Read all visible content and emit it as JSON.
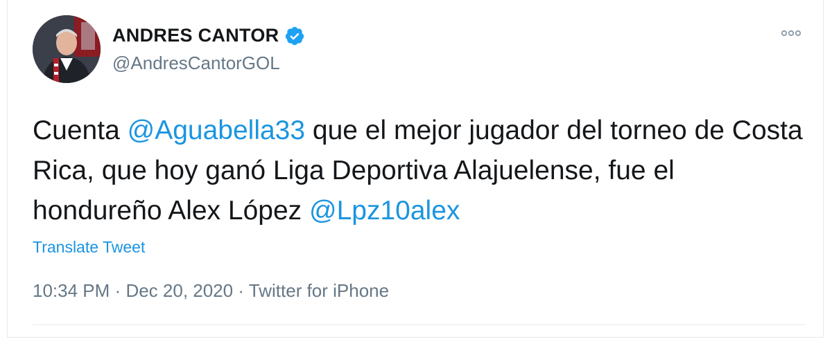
{
  "tweet": {
    "author": {
      "display_name": "ANDRES CANTOR",
      "handle": "@AndresCantorGOL"
    },
    "text": {
      "p1": "Cuenta ",
      "mention1": "@Aguabella33",
      "p2": " que el mejor jugador del torneo de Costa Rica, que hoy ganó Liga Deportiva Alajuelense, fue el hondureño Alex López ",
      "mention2": "@Lpz10alex"
    },
    "translate_label": "Translate Tweet",
    "time": "10:34 PM",
    "date": "Dec 20, 2020",
    "source": "Twitter for iPhone",
    "separator": "·"
  },
  "colors": {
    "accent": "#1b95e0",
    "verified": "#1da1f2",
    "secondary_text": "#657786"
  },
  "icons": {
    "verified": "verified-badge-icon",
    "more": "more-options-icon"
  }
}
